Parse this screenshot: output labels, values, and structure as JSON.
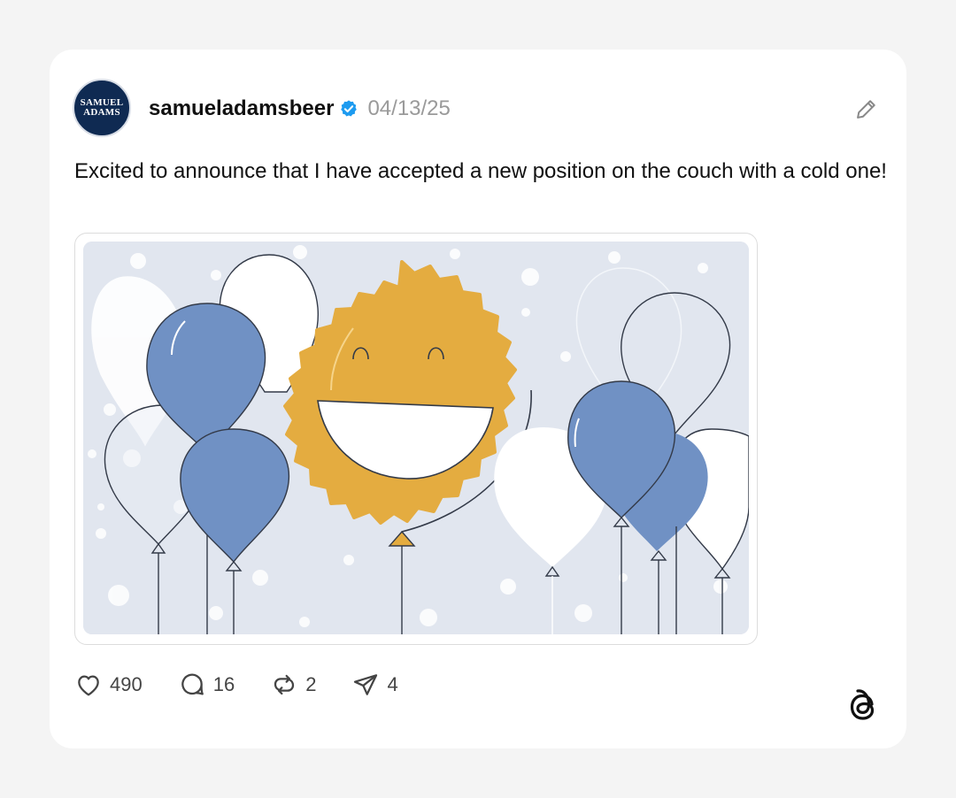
{
  "post": {
    "avatar_lines": [
      "SAMUEL",
      "ADAMS"
    ],
    "username": "samueladamsbeer",
    "date": "04/13/25",
    "text": "Excited to announce that I have accepted a new position on the couch with a cold one!"
  },
  "actions": {
    "likes": "490",
    "replies": "16",
    "reposts": "2",
    "shares": "4"
  },
  "colors": {
    "balloon_blue": "#7091c4",
    "sun_gold": "#e4ac40",
    "verified_blue": "#1d9bf0",
    "image_bg": "#e1e6ef"
  },
  "icons": [
    "pencil-icon",
    "verified-badge-icon",
    "heart-icon",
    "reply-icon",
    "repost-icon",
    "share-icon",
    "threads-logo-icon"
  ]
}
